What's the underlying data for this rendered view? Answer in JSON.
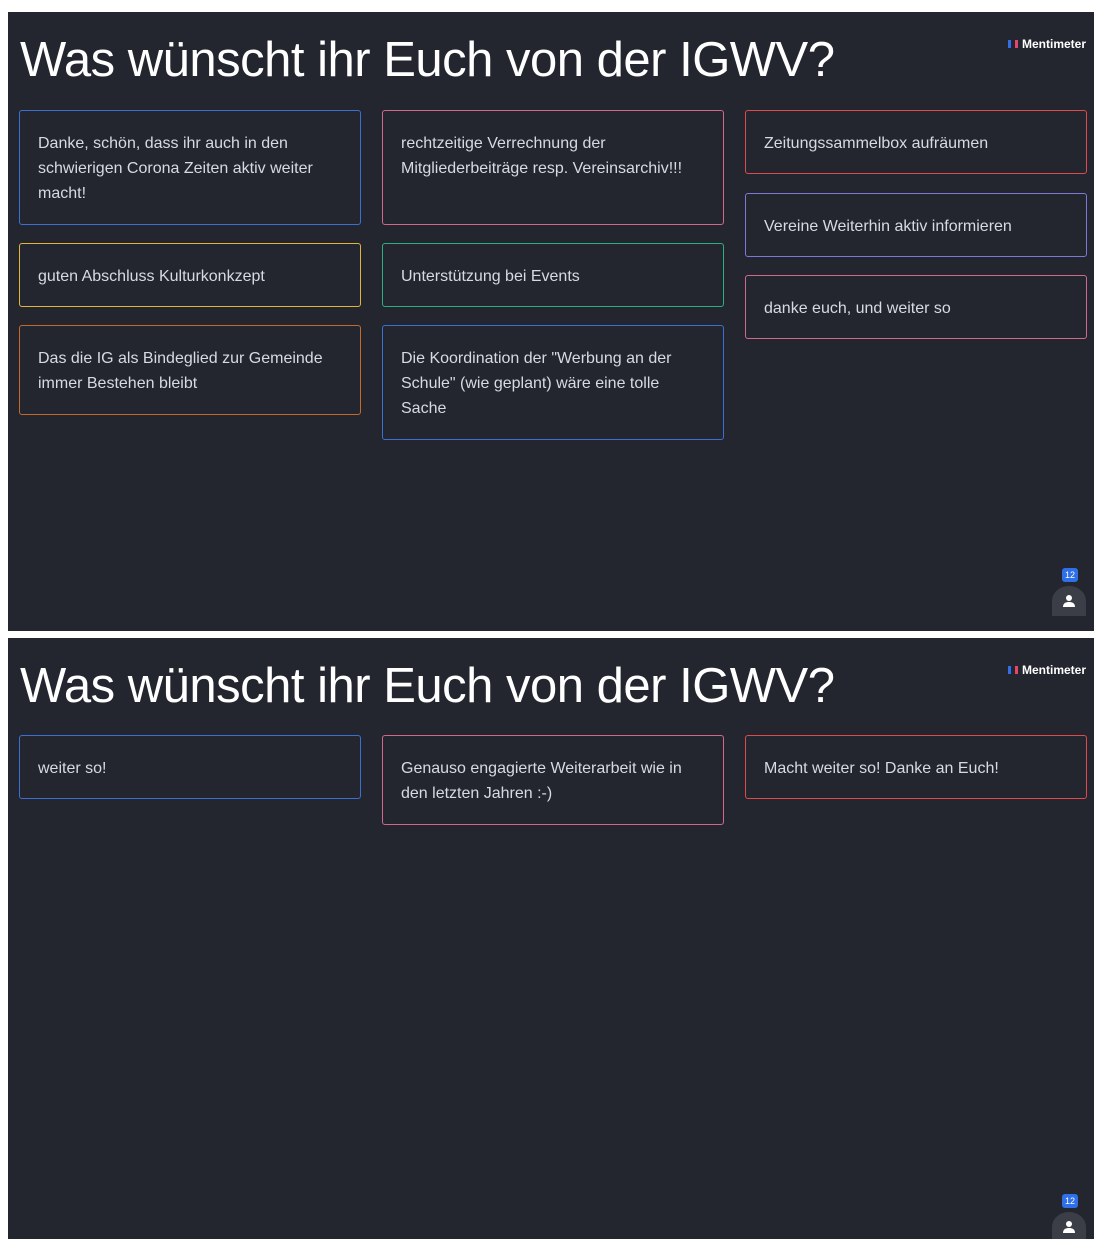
{
  "slides": [
    {
      "title": "Was wünscht ihr Euch von der IGWV?",
      "brand": "Mentimeter",
      "participant_count": "12",
      "cards": [
        "Danke, schön, dass ihr auch in den schwierigen Corona Zeiten aktiv weiter macht!",
        "guten Abschluss Kulturkonkzept",
        "Das die IG als Bindeglied zur Gemeinde immer Bestehen bleibt",
        "rechtzeitige Verrechnung der Mitgliederbeiträge resp. Vereinsarchiv!!!",
        "Unterstützung bei Events",
        "Die Koordination der \"Werbung an der Schule\" (wie geplant) wäre eine tolle Sache",
        "Zeitungssammelbox aufräumen",
        "Vereine Weiterhin aktiv informieren",
        "danke euch, und weiter so"
      ]
    },
    {
      "title": "Was wünscht ihr Euch von der IGWV?",
      "brand": "Mentimeter",
      "participant_count": "12",
      "cards": [
        "weiter so!",
        "Genauso engagierte Weiterarbeit wie in den letzten Jahren :-)",
        "Macht weiter so! Danke an Euch!"
      ]
    }
  ],
  "colors": {
    "background": "#23262f",
    "blue": "#3b6fd1",
    "pink": "#d0698c",
    "yellow": "#e1b53b",
    "green": "#2fae7f",
    "red": "#e04a4a",
    "purple": "#7b78d8",
    "orange": "#c4692c"
  }
}
